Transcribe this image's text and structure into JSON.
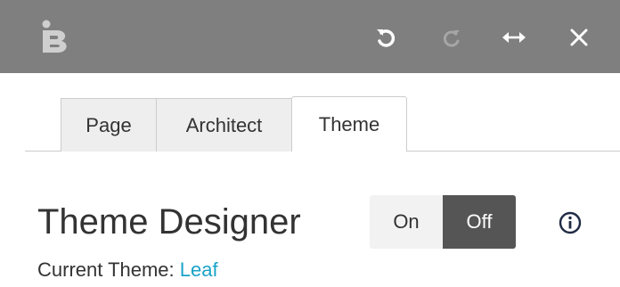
{
  "toolbar": {
    "logo_icon": "letter-b-logo",
    "undo_icon": "undo-icon",
    "redo_icon": "redo-icon",
    "resize_icon": "horizontal-resize-icon",
    "close_icon": "close-icon",
    "background_color": "#7f7f7f"
  },
  "tabs": [
    {
      "label": "Page",
      "active": false
    },
    {
      "label": "Architect",
      "active": false
    },
    {
      "label": "Theme",
      "active": true
    }
  ],
  "designer": {
    "title": "Theme Designer",
    "toggle": {
      "on_label": "On",
      "off_label": "Off",
      "selected": "Off"
    },
    "info_icon": "info-icon",
    "current_theme_label": "Current Theme: ",
    "current_theme_value": "Leaf",
    "link_color": "#1aa3c8"
  }
}
